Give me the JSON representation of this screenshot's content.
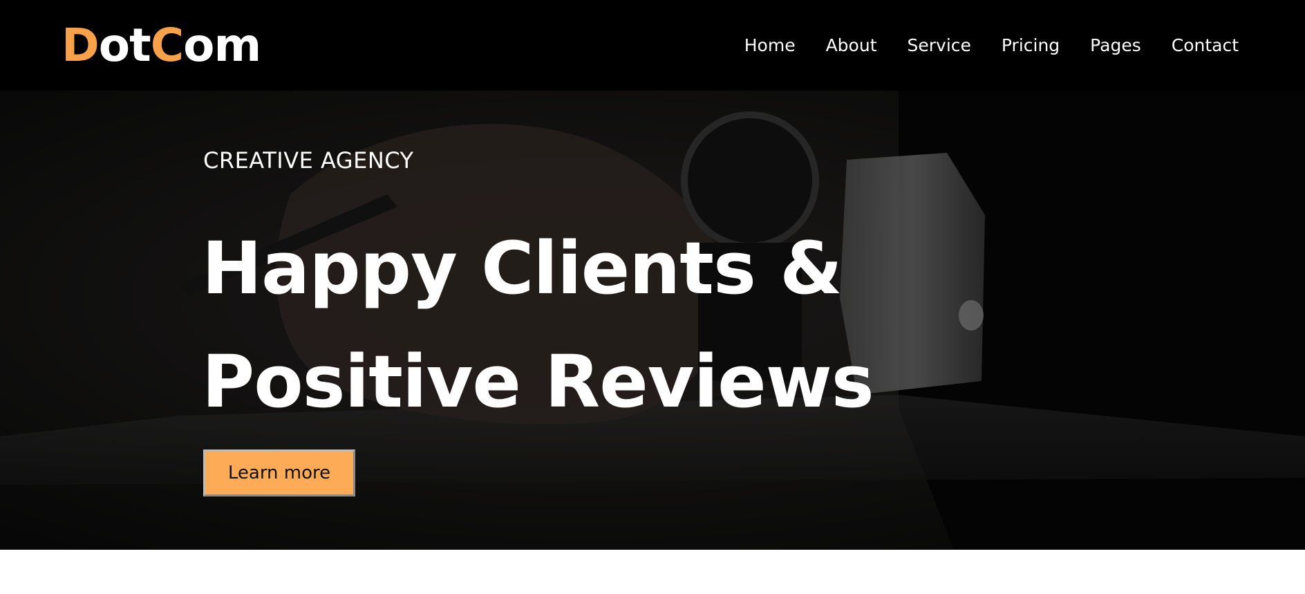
{
  "brand": {
    "logo_part1_accent": "D",
    "logo_part2": "ot",
    "logo_part3_accent": "C",
    "logo_part4": "om",
    "accent_color": "#f7a14a"
  },
  "nav": {
    "items": [
      {
        "label": "Home"
      },
      {
        "label": "About"
      },
      {
        "label": "Service"
      },
      {
        "label": "Pricing"
      },
      {
        "label": "Pages"
      },
      {
        "label": "Contact"
      }
    ]
  },
  "hero": {
    "eyebrow": "CREATIVE AGENCY",
    "headline_line1": "Happy Clients &",
    "headline_line2": "Positive Reviews",
    "cta_label": "Learn more",
    "cta_color": "#fdab56",
    "background_image": "dark photo of a hand in a suit sleeve with a wristwatch, holding a pen over paper"
  }
}
